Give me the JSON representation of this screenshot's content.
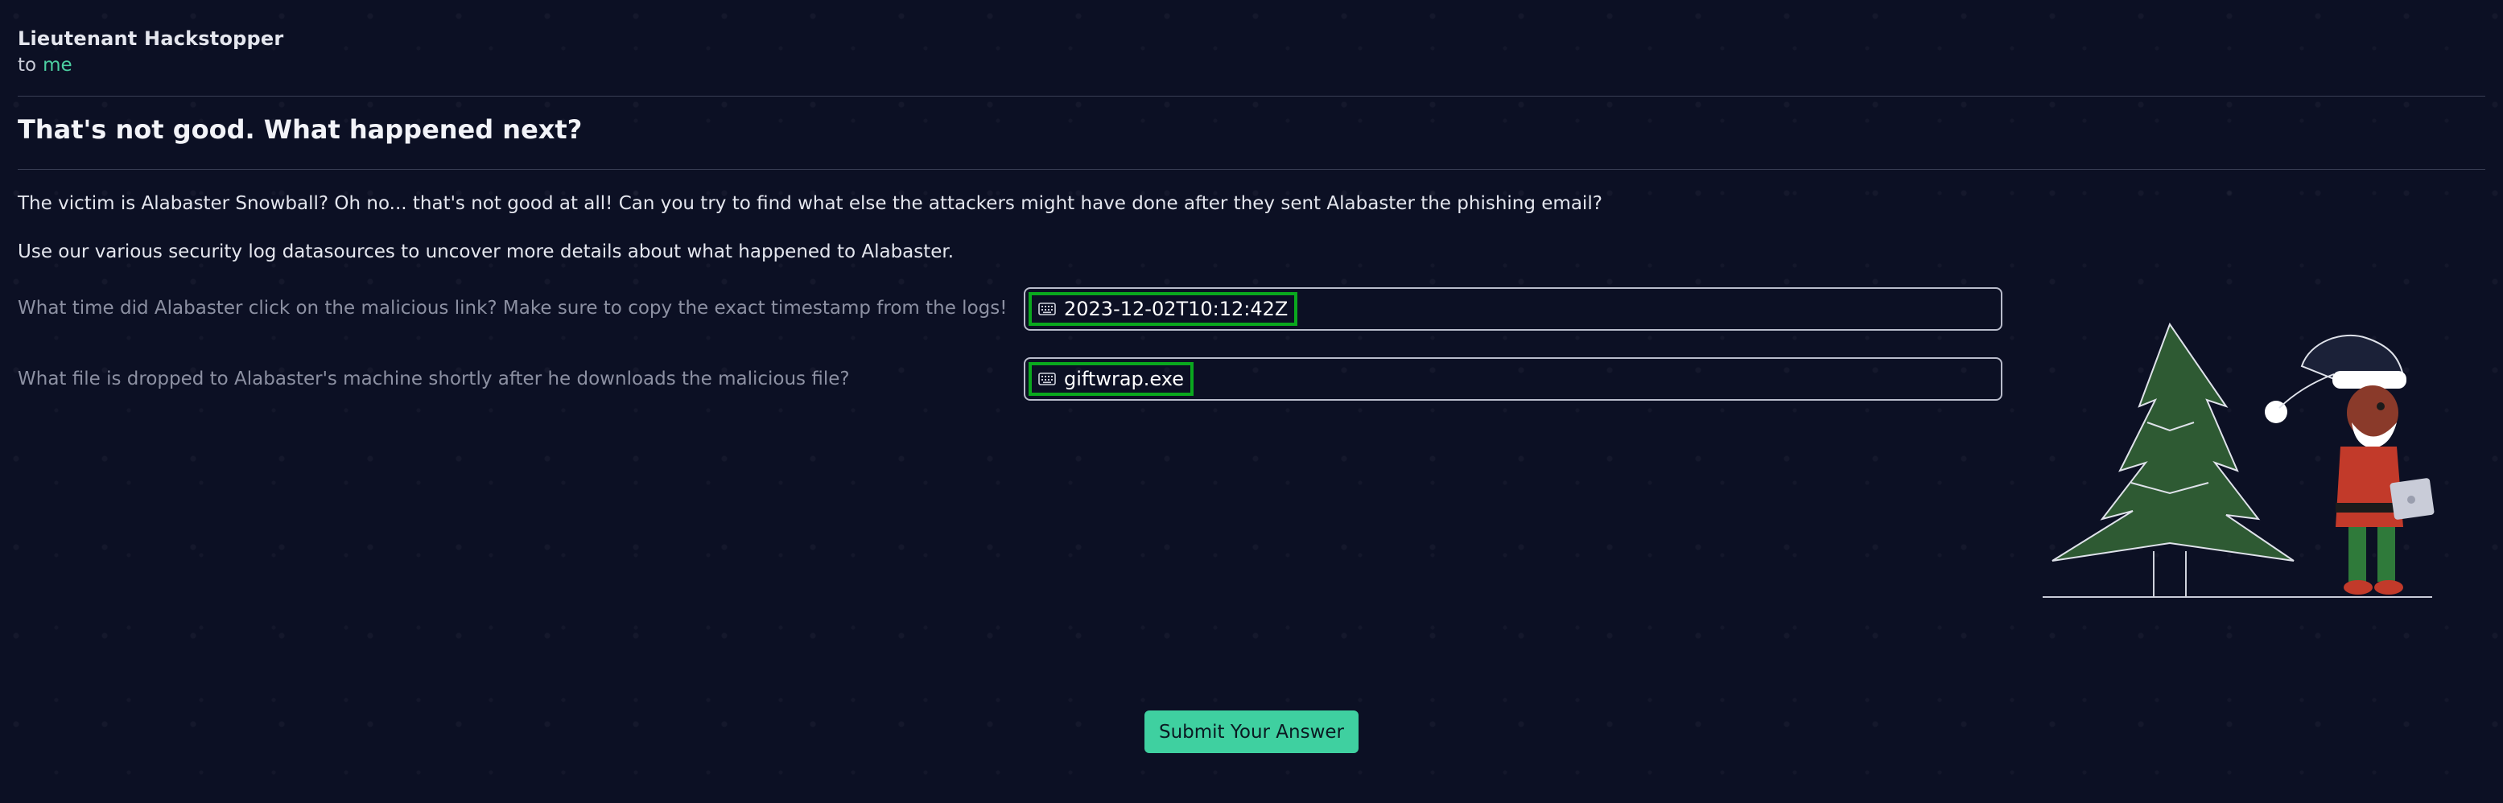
{
  "email": {
    "sender": "Lieutenant Hackstopper",
    "to_prefix": "to",
    "recipient": "me"
  },
  "content": {
    "title": "That's not good. What happened next?",
    "paragraphs": [
      "The victim is Alabaster Snowball? Oh no... that's not good at all! Can you try to find what else the attackers might have done after they sent Alabaster the phishing email?",
      "Use our various security log datasources to uncover more details about what happened to Alabaster."
    ]
  },
  "questions": [
    {
      "label": "What time did Alabaster click on the malicious link? Make sure to copy the exact timestamp from the logs!",
      "answer": "2023-12-02T10:12:42Z",
      "answer_icon": "keyboard-icon"
    },
    {
      "label": "What file is dropped to Alabaster's machine shortly after he downloads the malicious file?",
      "answer": "giftwrap.exe",
      "answer_icon": "keyboard-icon"
    }
  ],
  "submit": {
    "label": "Submit Your Answer"
  },
  "illustration": {
    "name": "elf-with-laptop-and-christmas-tree"
  },
  "colors": {
    "background": "#0c1024",
    "accent": "#3fd0a0",
    "answer_highlight": "#0aa81e"
  }
}
